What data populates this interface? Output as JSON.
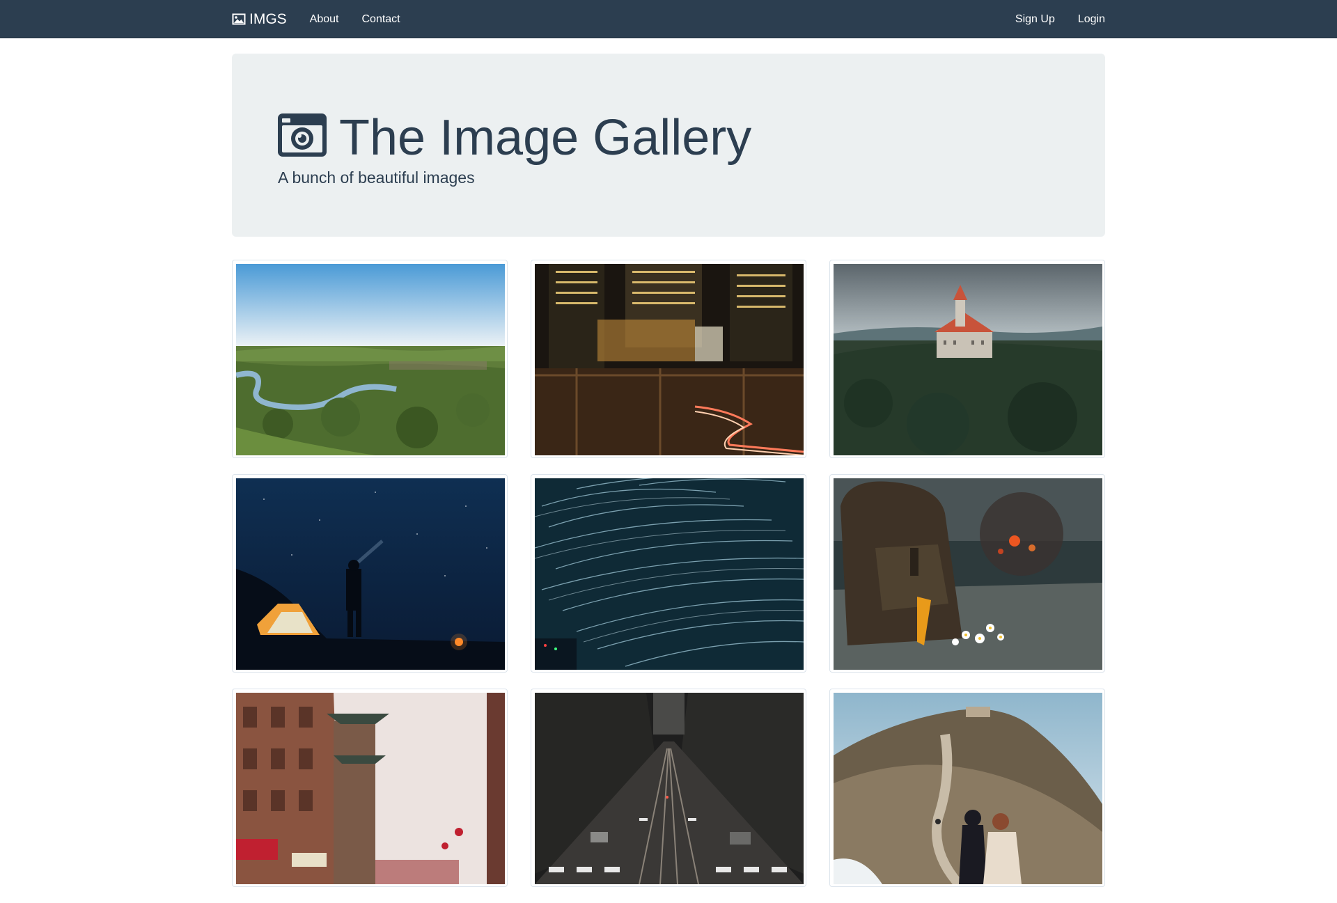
{
  "navbar": {
    "brand": "IMGS",
    "links_left": [
      "About",
      "Contact"
    ],
    "links_right": [
      "Sign Up",
      "Login"
    ],
    "background": "#2c3e50"
  },
  "jumbotron": {
    "title": "The Image Gallery",
    "subtitle": "A bunch of beautiful images",
    "icon": "camera-icon",
    "background": "#ecf0f1"
  },
  "gallery": {
    "images": [
      {
        "name": "river-landscape-image"
      },
      {
        "name": "city-night-railway-image"
      },
      {
        "name": "castle-on-hill-image"
      },
      {
        "name": "night-camping-image"
      },
      {
        "name": "star-trails-image"
      },
      {
        "name": "backpack-campfire-image"
      },
      {
        "name": "chinatown-street-image"
      },
      {
        "name": "steep-city-street-image"
      },
      {
        "name": "coastal-path-hikers-image"
      }
    ]
  }
}
